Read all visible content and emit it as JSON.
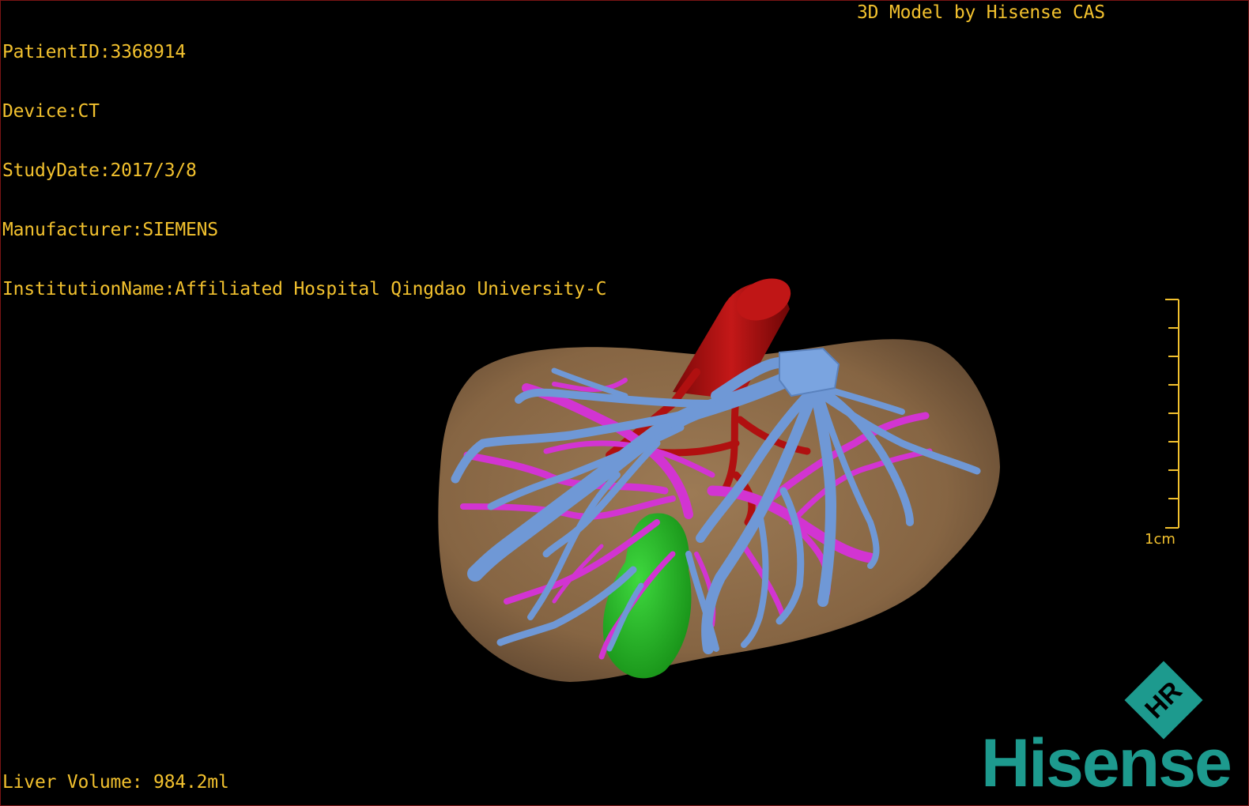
{
  "header": {
    "patient_id": "PatientID:3368914",
    "device": "Device:CT",
    "study_date": "StudyDate:2017/3/8",
    "manufacturer": "Manufacturer:SIEMENS",
    "institution": "InstitutionName:Affiliated Hospital Qingdao University-C"
  },
  "title": "3D Model by Hisense CAS",
  "footer": {
    "liver_volume": "Liver Volume: 984.2ml"
  },
  "scale_bar": {
    "label": "1cm"
  },
  "logo": {
    "wordmark": "Hisense",
    "badge_text": "HR"
  },
  "colors": {
    "overlay_text": "#f2c12e",
    "liver": "#8b6a48",
    "aorta": "#b01010",
    "portal_vein": "#6f98d6",
    "hepatic_vein": "#d234d2",
    "gallbladder": "#22b022",
    "brand": "#1d9a8e",
    "viewport_border": "#7a1414"
  },
  "icons": {
    "brand_badge": "hr-diamond-icon"
  }
}
